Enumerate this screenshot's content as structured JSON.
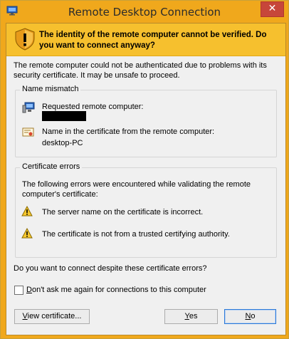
{
  "window": {
    "title": "Remote Desktop Connection",
    "close_glyph": "✕",
    "app_icon": "remote-desktop-icon"
  },
  "banner": {
    "icon": "shield-warning-icon",
    "text": "The identity of the remote computer cannot be verified. Do you want to connect anyway?"
  },
  "intro_text": "The remote computer could not be authenticated due to problems with its security certificate. It may be unsafe to proceed.",
  "name_mismatch": {
    "heading": "Name mismatch",
    "requested_label": "Requested remote computer:",
    "certificate_label": "Name in the certificate from the remote computer:",
    "certificate_name": "desktop-PC"
  },
  "certificate_errors": {
    "heading": "Certificate errors",
    "description": "The following errors were encountered while validating the remote computer's certificate:",
    "errors": [
      "The server name on the certificate is incorrect.",
      "The certificate is not from a trusted certifying authority."
    ]
  },
  "question": "Do you want to connect despite these certificate errors?",
  "checkbox": {
    "label_prefix": "D",
    "label_rest": "on't ask me again for connections to this computer",
    "checked": false
  },
  "buttons": {
    "view_prefix": "V",
    "view_rest": "iew certificate...",
    "yes_prefix": "Y",
    "yes_rest": "es",
    "no_prefix": "N",
    "no_rest": "o"
  },
  "colors": {
    "banner": "#f6c02e",
    "titlebar": "#f0a81c",
    "close_button": "#c7463a"
  }
}
